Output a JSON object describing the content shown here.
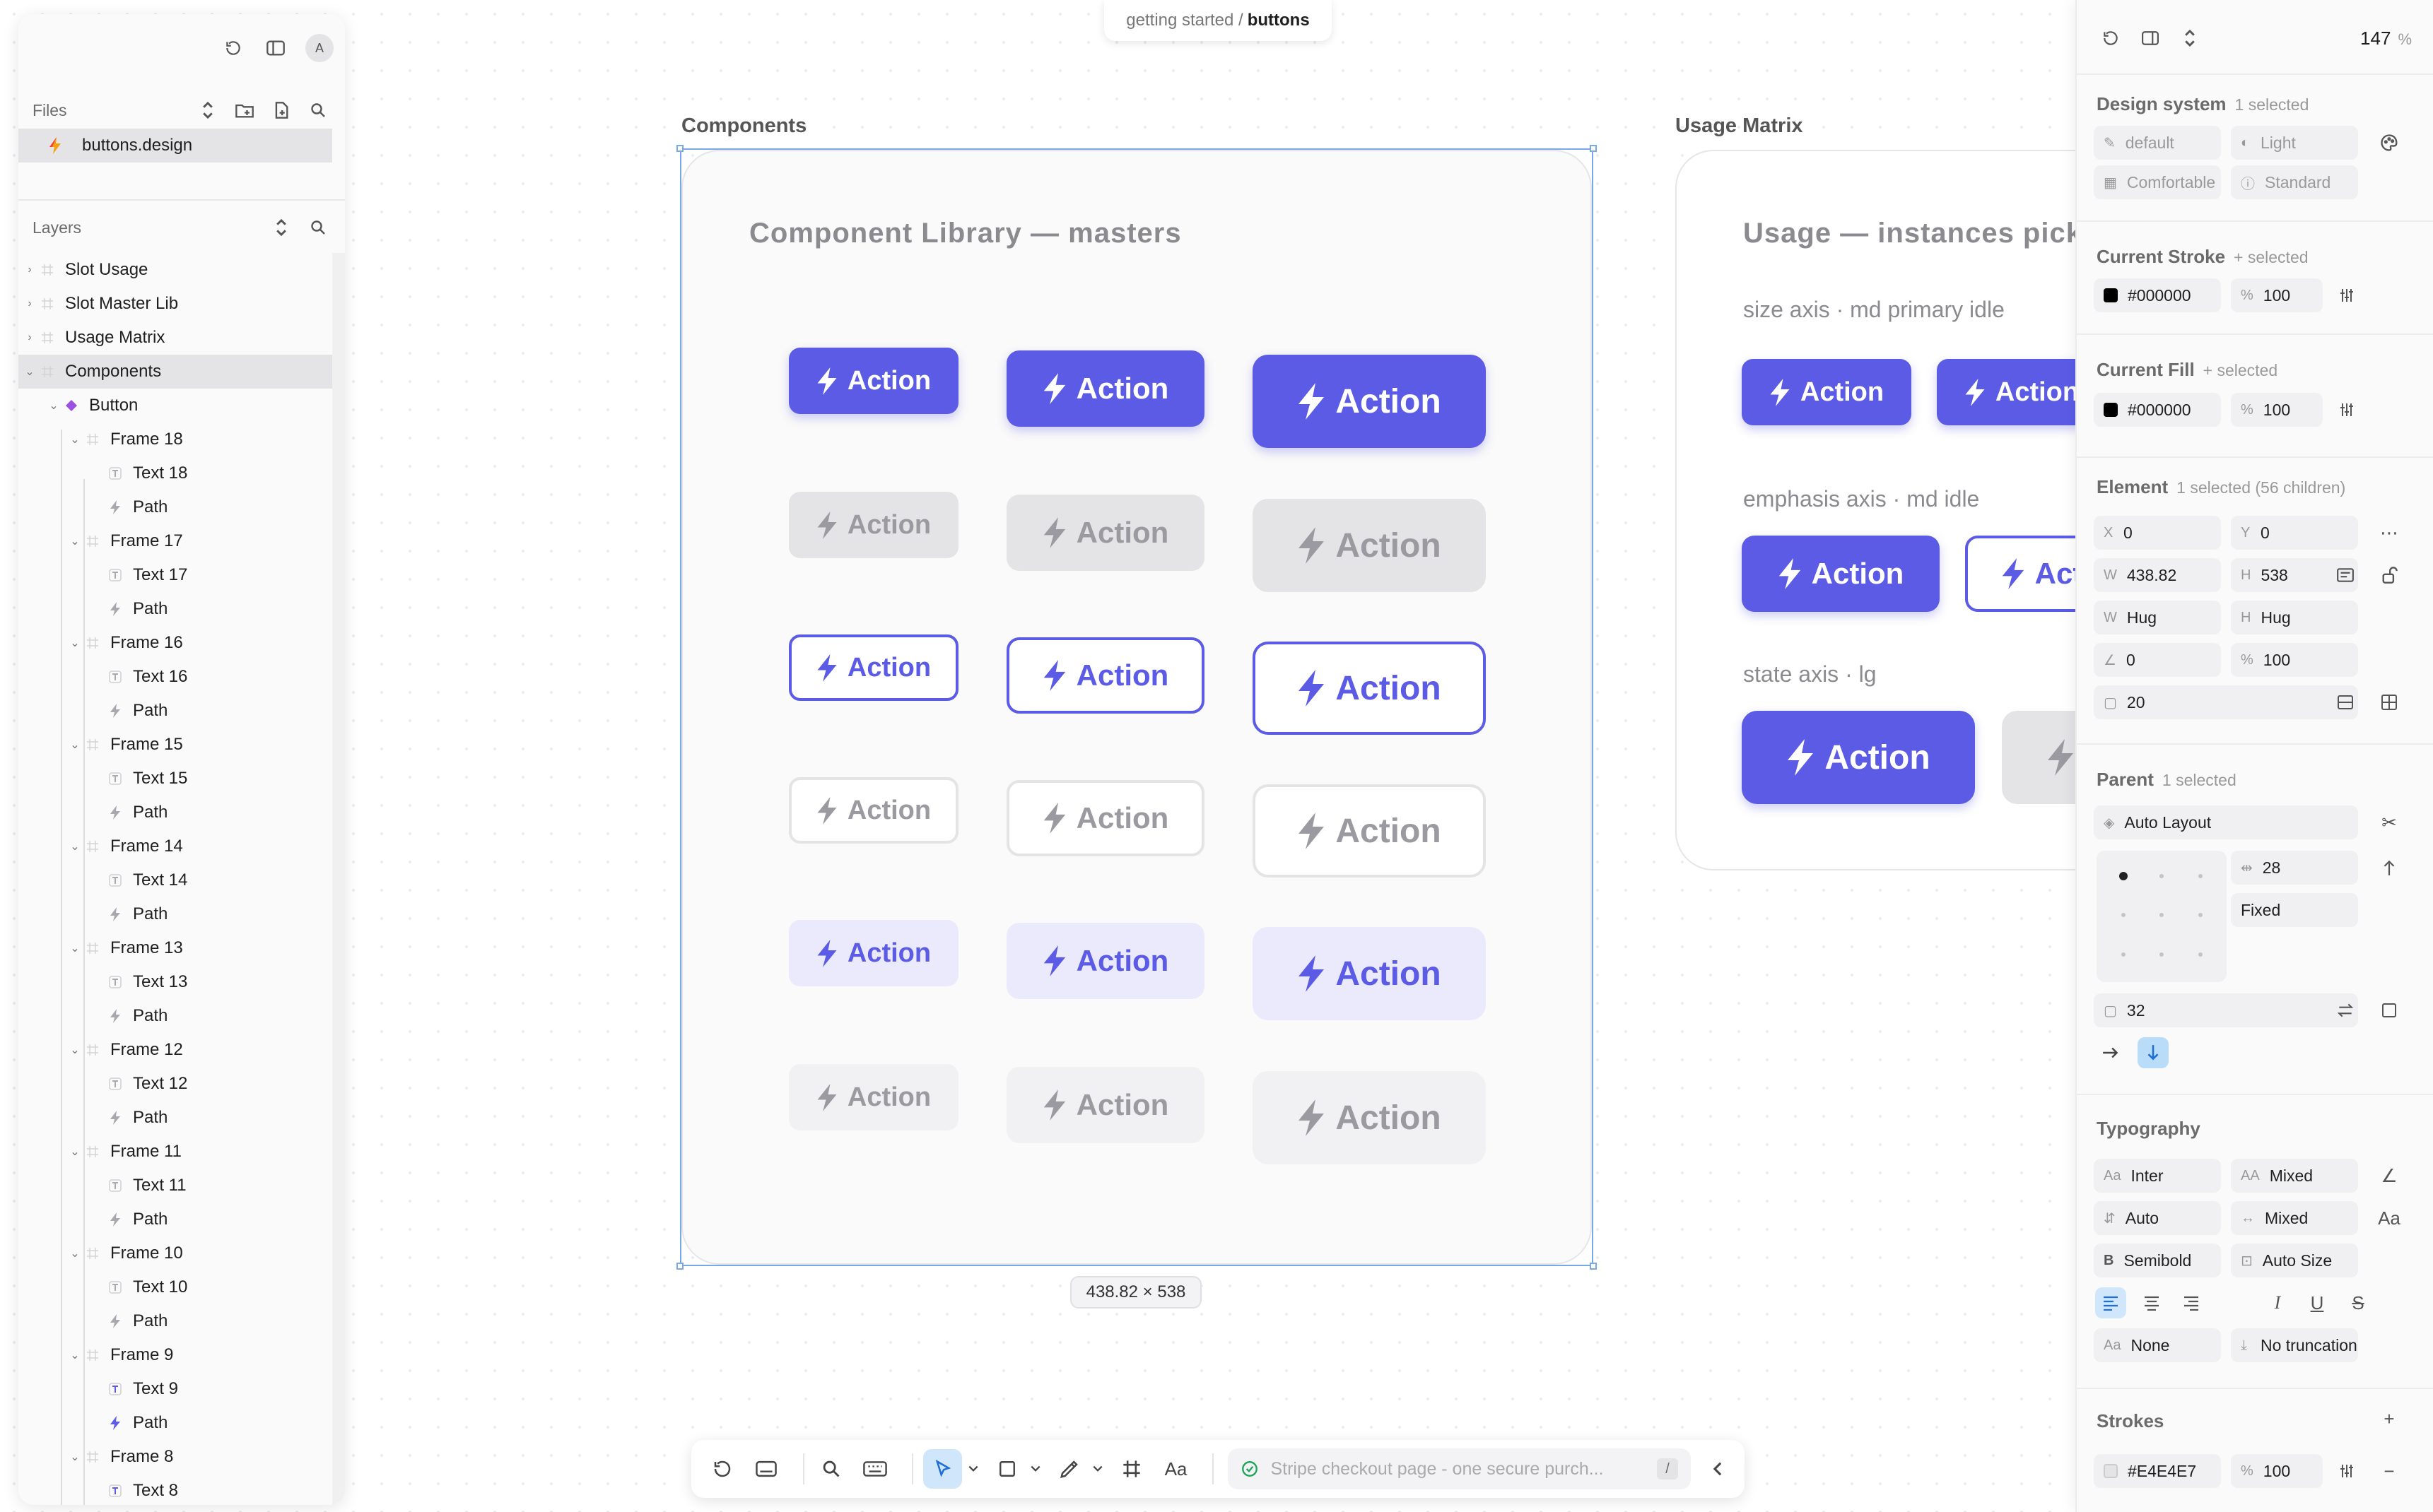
{
  "breadcrumb": {
    "parent": "getting started /",
    "current": "buttons"
  },
  "left_panel": {
    "avatar": "A",
    "files_heading": "Files",
    "file_name": "buttons.design",
    "layers_heading": "Layers",
    "layers": [
      {
        "label": "Slot Usage",
        "depth": 0,
        "caret": "›",
        "icon": "frame"
      },
      {
        "label": "Slot Master Lib",
        "depth": 0,
        "caret": "›",
        "icon": "frame"
      },
      {
        "label": "Usage Matrix",
        "depth": 0,
        "caret": "›",
        "icon": "frame"
      },
      {
        "label": "Components",
        "depth": 0,
        "caret": "⌄",
        "icon": "frame",
        "selected": true
      },
      {
        "label": "Button",
        "depth": 1,
        "caret": "⌄",
        "icon": "component"
      },
      {
        "label": "Frame 18",
        "depth": 2,
        "caret": "⌄",
        "icon": "frame"
      },
      {
        "label": "Text 18",
        "depth": 3,
        "icon": "text"
      },
      {
        "label": "Path",
        "depth": 3,
        "icon": "path"
      },
      {
        "label": "Frame 17",
        "depth": 2,
        "caret": "⌄",
        "icon": "frame"
      },
      {
        "label": "Text 17",
        "depth": 3,
        "icon": "text"
      },
      {
        "label": "Path",
        "depth": 3,
        "icon": "path"
      },
      {
        "label": "Frame 16",
        "depth": 2,
        "caret": "⌄",
        "icon": "frame"
      },
      {
        "label": "Text 16",
        "depth": 3,
        "icon": "text"
      },
      {
        "label": "Path",
        "depth": 3,
        "icon": "path"
      },
      {
        "label": "Frame 15",
        "depth": 2,
        "caret": "⌄",
        "icon": "frame"
      },
      {
        "label": "Text 15",
        "depth": 3,
        "icon": "text"
      },
      {
        "label": "Path",
        "depth": 3,
        "icon": "path"
      },
      {
        "label": "Frame 14",
        "depth": 2,
        "caret": "⌄",
        "icon": "frame"
      },
      {
        "label": "Text 14",
        "depth": 3,
        "icon": "text"
      },
      {
        "label": "Path",
        "depth": 3,
        "icon": "path"
      },
      {
        "label": "Frame 13",
        "depth": 2,
        "caret": "⌄",
        "icon": "frame"
      },
      {
        "label": "Text 13",
        "depth": 3,
        "icon": "text"
      },
      {
        "label": "Path",
        "depth": 3,
        "icon": "path"
      },
      {
        "label": "Frame 12",
        "depth": 2,
        "caret": "⌄",
        "icon": "frame"
      },
      {
        "label": "Text 12",
        "depth": 3,
        "icon": "text"
      },
      {
        "label": "Path",
        "depth": 3,
        "icon": "path"
      },
      {
        "label": "Frame 11",
        "depth": 2,
        "caret": "⌄",
        "icon": "frame"
      },
      {
        "label": "Text 11",
        "depth": 3,
        "icon": "text"
      },
      {
        "label": "Path",
        "depth": 3,
        "icon": "path"
      },
      {
        "label": "Frame 10",
        "depth": 2,
        "caret": "⌄",
        "icon": "frame"
      },
      {
        "label": "Text 10",
        "depth": 3,
        "icon": "text"
      },
      {
        "label": "Path",
        "depth": 3,
        "icon": "path"
      },
      {
        "label": "Frame 9",
        "depth": 2,
        "caret": "⌄",
        "icon": "frame"
      },
      {
        "label": "Text 9",
        "depth": 3,
        "icon": "text",
        "accent": true
      },
      {
        "label": "Path",
        "depth": 3,
        "icon": "path",
        "accent": true
      },
      {
        "label": "Frame 8",
        "depth": 2,
        "caret": "⌄",
        "icon": "frame"
      },
      {
        "label": "Text 8",
        "depth": 3,
        "icon": "text",
        "accent": true
      }
    ]
  },
  "canvas": {
    "components_label": "Components",
    "components_title": "Component Library — masters",
    "usage_label": "Usage Matrix",
    "usage_title": "Usage — instances picked",
    "size_axis_label": "size axis · md primary idle",
    "emphasis_axis_label": "emphasis axis · md idle",
    "state_axis_label": "state axis · lg",
    "button_label": "Action",
    "size_chip": "438.82 × 538",
    "button_rows": [
      "primary",
      "disabled",
      "outline",
      "outline-disabled",
      "ghost",
      "ghost-disabled"
    ],
    "button_sizes": [
      "sm",
      "md",
      "lg"
    ]
  },
  "bottom_toolbar": {
    "text_tool_label": "Aa",
    "prompt_placeholder": "Stripe checkout page - one secure purch...",
    "prompt_shortcut": "/"
  },
  "right_panel": {
    "zoom_value": "147",
    "zoom_unit": "%",
    "design_system": {
      "title": "Design system",
      "count": "1 selected",
      "theme": "default",
      "mode": "Light",
      "density": "Comfortable",
      "variant": "Standard"
    },
    "stroke": {
      "title": "Current Stroke",
      "count": "+ selected",
      "color": "#000000",
      "opacity": "100"
    },
    "fill": {
      "title": "Current Fill",
      "count": "+ selected",
      "color": "#000000",
      "opacity": "100"
    },
    "element": {
      "title": "Element",
      "count": "1 selected (56 children)",
      "x": "0",
      "y": "0",
      "w": "438.82",
      "h": "538",
      "w_mode": "Hug",
      "h_mode": "Hug",
      "rotation": "0",
      "opacity": "100",
      "radius": "20"
    },
    "parent": {
      "title": "Parent",
      "count": "1 selected",
      "layout": "Auto Layout",
      "gap": "28",
      "sizing": "Fixed",
      "padding": "32"
    },
    "typography": {
      "title": "Typography",
      "font": "Inter",
      "size": "Mixed",
      "line_height": "Auto",
      "letter_spacing": "Mixed",
      "weight": "Semibold",
      "resize": "Auto Size",
      "case": "None",
      "truncation": "No truncation"
    },
    "strokes": {
      "title": "Strokes",
      "color": "#E4E4E7",
      "opacity": "100"
    }
  },
  "colors": {
    "accent": "#5b5be6",
    "selection": "#7aa7e6",
    "canvas_bg": "#ffffff"
  }
}
